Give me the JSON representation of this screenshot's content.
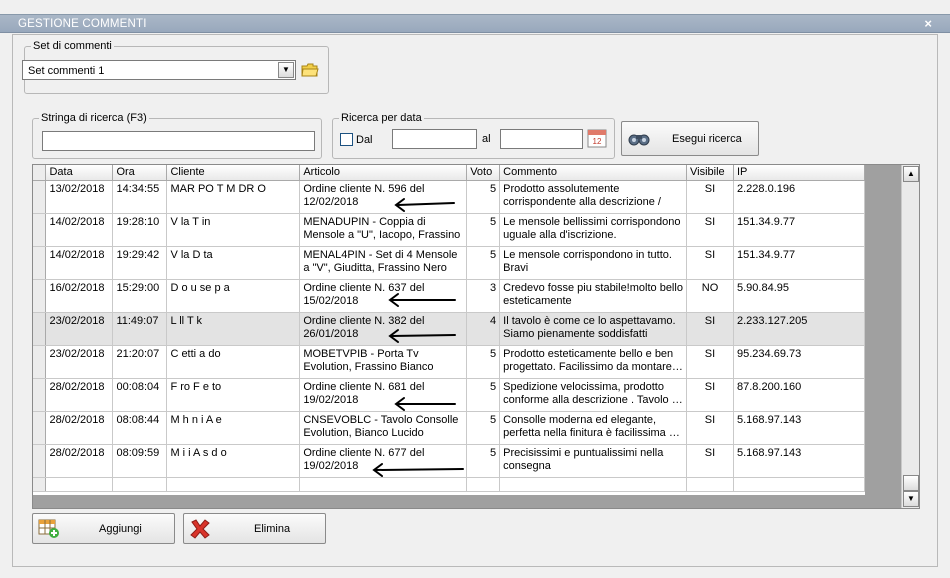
{
  "window": {
    "title": "GESTIONE COMMENTI",
    "close": "×"
  },
  "set_group": {
    "legend": "Set di commenti",
    "selected": "Set commenti 1",
    "folder_icon": "folder-icon"
  },
  "search_group": {
    "legend": "Stringa di ricerca (F3)",
    "value": ""
  },
  "date_group": {
    "legend": "Ricerca per data",
    "dal_label": "Dal",
    "al_label": "al",
    "from": "",
    "to": "",
    "calendar_icon": "calendar-icon"
  },
  "search_button": {
    "label": "Esegui ricerca",
    "icon": "binoculars-icon"
  },
  "table": {
    "columns": [
      "Data",
      "Ora",
      "Cliente",
      "Articolo",
      "Voto",
      "Commento",
      "Visibile",
      "IP"
    ],
    "rows": [
      {
        "data": "13/02/2018",
        "ora": "14:34:55",
        "cliente": "MAR PO T  M  DR  O",
        "articolo": "Ordine cliente N. 596 del 12/02/2018",
        "voto": "5",
        "commento": "Prodotto assolutemente corrispondente alla descrizione / fot…",
        "visibile": "SI",
        "ip": "2.228.0.196"
      },
      {
        "data": "14/02/2018",
        "ora": "19:28:10",
        "cliente": "V    la  T   in",
        "articolo": "MENADUPIN - Coppia di Mensole a \"U\", Iacopo, Frassino Nero",
        "voto": "5",
        "commento": "Le mensole bellissimi corrispondono uguale alla d'iscrizione.",
        "visibile": "SI",
        "ip": "151.34.9.77"
      },
      {
        "data": "14/02/2018",
        "ora": "19:29:42",
        "cliente": "V    la  D   ta",
        "articolo": "MENAL4PIN - Set di 4 Mensole a \"V\", Giuditta, Frassino Nero",
        "voto": "5",
        "commento": "Le mensole corrispondono in tutto. Bravi",
        "visibile": "SI",
        "ip": "151.34.9.77"
      },
      {
        "data": "16/02/2018",
        "ora": "15:29:00",
        "cliente": "D  o   u  se  p a",
        "articolo": "Ordine cliente N. 637 del 15/02/2018",
        "voto": "3",
        "commento": "Credevo fosse piu stabile!molto bello esteticamente",
        "visibile": "NO",
        "ip": "5.90.84.95"
      },
      {
        "data": "23/02/2018",
        "ora": "11:49:07",
        "cliente": "L      ll  T    k",
        "articolo": "Ordine cliente N. 382 del 26/01/2018",
        "voto": "4",
        "commento": "Il tavolo è come ce lo aspettavamo. Siamo pienamente soddisfatti dell'a…",
        "visibile": "SI",
        "ip": "2.233.127.205"
      },
      {
        "data": "23/02/2018",
        "ora": "21:20:07",
        "cliente": "C    etti    a  do",
        "articolo": "MOBETVPIB - Porta Tv Evolution, Frassino Bianco",
        "voto": "5",
        "commento": "Prodotto esteticamente bello e ben progettato. Facilissimo da montare…",
        "visibile": "SI",
        "ip": "95.234.69.73"
      },
      {
        "data": "28/02/2018",
        "ora": "00:08:04",
        "cliente": "F    ro  F  e  to",
        "articolo": "Ordine cliente N. 681 del 19/02/2018",
        "voto": "5",
        "commento": "Spedizione velocissima, prodotto conforme alla descrizione . Tavolo …",
        "visibile": "SI",
        "ip": "87.8.200.160"
      },
      {
        "data": "28/02/2018",
        "ora": "08:08:44",
        "cliente": "M  h   n  i  A  e",
        "articolo": "CNSEVOBLC - Tavolo Consolle Evolution, Bianco Lucido",
        "voto": "5",
        "commento": "Consolle moderna ed elegante, perfetta nella finitura è facilissima …",
        "visibile": "SI",
        "ip": "5.168.97.143"
      },
      {
        "data": "28/02/2018",
        "ora": "08:09:59",
        "cliente": "M   i    i  A  s  d o",
        "articolo": "Ordine cliente N. 677 del 19/02/2018",
        "voto": "5",
        "commento": "Precisissimi e puntualissimi nella consegna",
        "visibile": "SI",
        "ip": "5.168.97.143"
      }
    ]
  },
  "buttons": {
    "add": {
      "label": "Aggiungi",
      "icon": "grid-add-icon"
    },
    "delete": {
      "label": "Elimina",
      "icon": "red-x-icon"
    }
  },
  "colors": {
    "titlebar": "#9aabbe",
    "selected_row": "#e3e3e3",
    "delete_x": "#d9342b"
  }
}
